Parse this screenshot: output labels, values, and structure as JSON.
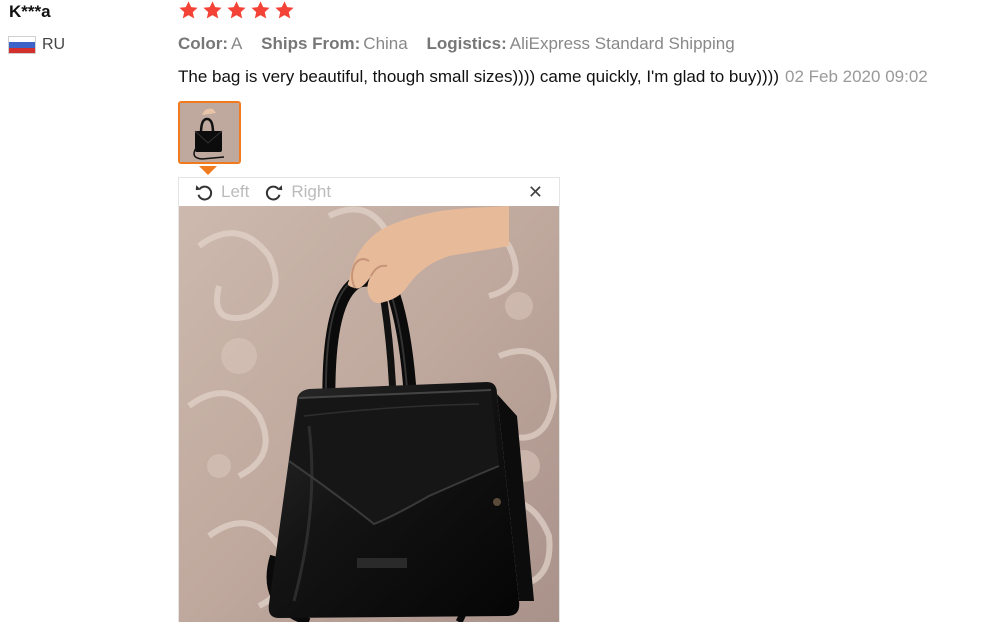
{
  "review": {
    "user_name": "K***a",
    "country_code": "RU",
    "rating": 5,
    "rating_color": "#f44336",
    "attributes": [
      {
        "key": "Color:",
        "value": "A"
      },
      {
        "key": "Ships From:",
        "value": "China"
      },
      {
        "key": "Logistics:",
        "value": "AliExpress Standard Shipping"
      }
    ],
    "text": "The bag is very beautiful, though small sizes)))) came quickly, I'm glad to buy))))",
    "date": "02 Feb 2020 09:02"
  },
  "viewer": {
    "rotate_left_label": "Left",
    "rotate_right_label": "Right",
    "rotate_left_icon": "rotate-left-icon",
    "rotate_right_icon": "rotate-right-icon",
    "close_icon": "close-icon",
    "close_glyph": "✕"
  },
  "colors": {
    "accent": "#f07a1d"
  }
}
